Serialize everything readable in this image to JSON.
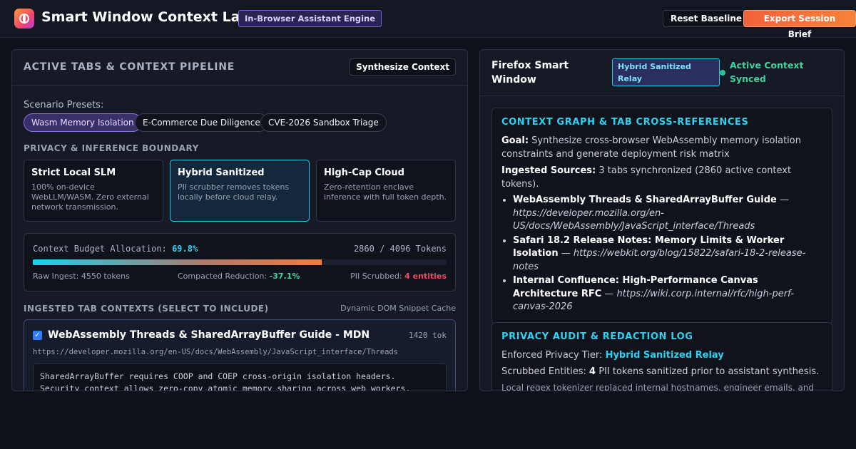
{
  "header": {
    "title": "Smart Window Context Lab",
    "engine_badge": "In-Browser Assistant Engine",
    "reset_label": "Reset Baseline",
    "export_label": "Export Session Brief"
  },
  "pipeline": {
    "title": "ACTIVE TABS & CONTEXT PIPELINE",
    "synthesize_label": "Synthesize Context",
    "presets_label": "Scenario Presets:",
    "presets": [
      "Wasm Memory Isolation",
      "E-Commerce Due Diligence",
      "CVE-2026 Sandbox Triage"
    ],
    "boundary_label": "PRIVACY & INFERENCE BOUNDARY",
    "tiers": [
      {
        "name": "Strict Local SLM",
        "desc": "100% on-device WebLLM/WASM. Zero external network transmission."
      },
      {
        "name": "Hybrid Sanitized",
        "desc": "PII scrubber removes tokens locally before cloud relay."
      },
      {
        "name": "High-Cap Cloud",
        "desc": "Zero-retention enclave inference with full token depth."
      }
    ],
    "budget": {
      "label": "Context Budget Allocation:",
      "percent": "69.8%",
      "percent_value": 69.8,
      "tokens": "2860 / 4096 Tokens",
      "raw_label": "Raw Ingest: 4550 tokens",
      "compacted_label": "Compacted Reduction:",
      "compacted_value": "-37.1%",
      "pii_label": "PII Scrubbed:",
      "pii_value": "4 entities"
    },
    "ingested_label": "INGESTED TAB CONTEXTS (SELECT TO INCLUDE)",
    "cache_label": "Dynamic DOM Snippet Cache",
    "tab": {
      "title": "WebAssembly Threads & SharedArrayBuffer Guide - MDN",
      "tokens": "1420 tok",
      "url": "https://developer.mozilla.org/en-US/docs/WebAssembly/JavaScript_interface/Threads",
      "snippet_line1": "SharedArrayBuffer requires COOP and COEP cross-origin isolation headers.",
      "snippet_line2": "Security context allows zero-copy atomic memory sharing across web workers."
    }
  },
  "smart_window": {
    "title": "Firefox Smart Window",
    "relay_badge": "Hybrid Sanitized Relay",
    "sync_status": "Active Context Synced",
    "graph": {
      "title": "CONTEXT GRAPH & TAB CROSS-REFERENCES",
      "goal_label": "Goal:",
      "goal_text": "Synthesize cross-browser WebAssembly memory isolation constraints and generate deployment risk matrix",
      "sources_label": "Ingested Sources:",
      "sources_text": "3 tabs synchronized (2860 active context tokens).",
      "sources": [
        {
          "title": "WebAssembly Threads & SharedArrayBuffer Guide",
          "url": "https://developer.mozilla.org/en-US/docs/WebAssembly/JavaScript_interface/Threads"
        },
        {
          "title": "Safari 18.2 Release Notes: Memory Limits & Worker Isolation",
          "url": "https://webkit.org/blog/15822/safari-18-2-release-notes"
        },
        {
          "title": "Internal Confluence: High-Performance Canvas Architecture RFC",
          "url": "https://wiki.corp.internal/rfc/high-perf-canvas-2026"
        }
      ]
    },
    "audit": {
      "title": "PRIVACY AUDIT & REDACTION LOG",
      "tier_label": "Enforced Privacy Tier:",
      "tier_value": "Hybrid Sanitized Relay",
      "scrubbed_label": "Scrubbed Entities:",
      "scrubbed_count": "4",
      "scrubbed_text": "PII tokens sanitized prior to assistant synthesis.",
      "log_line": "Local regex tokenizer replaced internal hostnames, engineer emails, and"
    }
  },
  "colors": {
    "accent": "#2fd0f0",
    "success": "#3fd3a0",
    "danger": "#f04a66",
    "brand": "#f2613a"
  }
}
